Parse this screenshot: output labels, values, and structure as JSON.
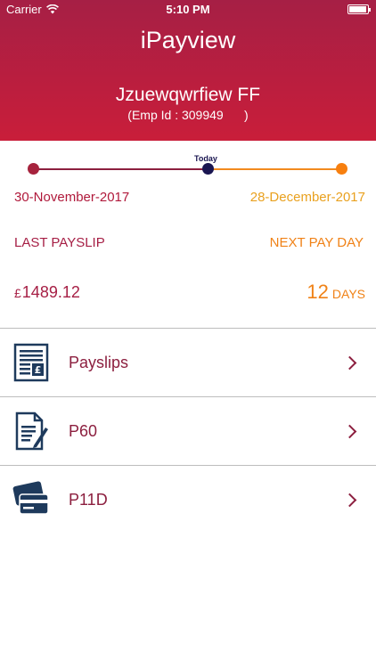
{
  "status_bar": {
    "carrier": "Carrier",
    "time": "5:10 PM"
  },
  "header": {
    "title": "iPayview",
    "user_name": "Jzuewqwrfiew FF",
    "emp_id": "(Emp Id : 309949      )"
  },
  "timeline": {
    "today_label": "Today",
    "start_date": "30-November-2017",
    "end_date": "28-December-2017"
  },
  "summary": {
    "last_payslip_label": "LAST PAYSLIP",
    "next_pay_day_label": "NEXT PAY DAY",
    "currency": "£",
    "last_amount": "1489.12",
    "days_count": "12",
    "days_unit": "DAYS"
  },
  "colors": {
    "brand": "#a61f45",
    "accent_orange": "#f08217",
    "navy": "#1a1651"
  },
  "menu": {
    "items": [
      {
        "label": "Payslips",
        "icon": "payslip-document-icon"
      },
      {
        "label": "P60",
        "icon": "p60-document-pen-icon"
      },
      {
        "label": "P11D",
        "icon": "p11d-cards-icon"
      }
    ]
  }
}
